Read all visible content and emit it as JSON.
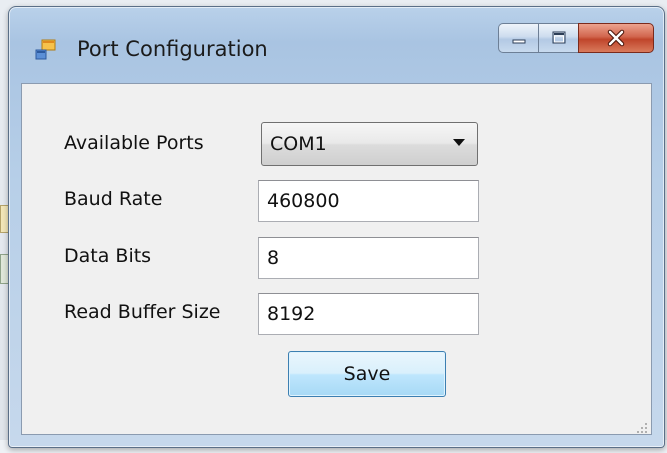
{
  "window": {
    "title": "Port Configuration"
  },
  "form": {
    "ports_label": "Available Ports",
    "ports_value": "COM1",
    "baud_label": "Baud Rate",
    "baud_value": "460800",
    "data_bits_label": "Data Bits",
    "data_bits_value": "8",
    "buffer_label": "Read Buffer Size",
    "buffer_value": "8192",
    "save_label": "Save"
  },
  "colors": {
    "titlebar": "#b9d1ea",
    "close_button": "#c0452b",
    "client_bg": "#f0f0f0",
    "save_button": "#bee6fd"
  }
}
